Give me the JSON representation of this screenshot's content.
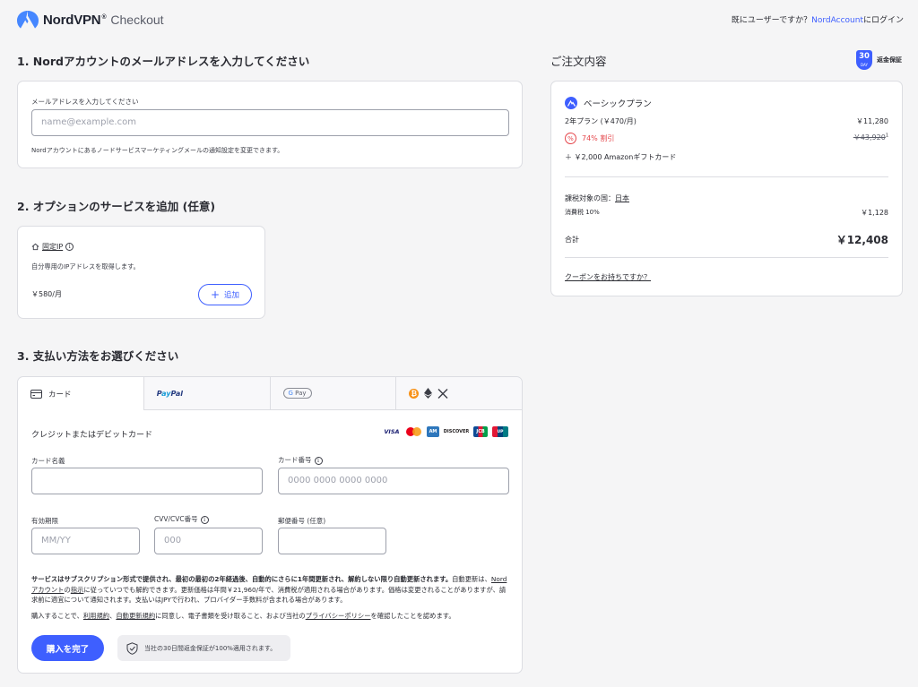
{
  "header": {
    "brand": "NordVPN",
    "tm": "®",
    "subtitle": "Checkout",
    "login_prefix": "既にユーザーですか？",
    "login_link": "NordAccount",
    "login_suffix": "にログイン"
  },
  "section1": {
    "title": "1. Nordアカウントのメールアドレスを入力してください",
    "email_label": "メールアドレスを入力してください",
    "email_placeholder": "name@example.com",
    "note": "Nordアカウントにあるノードサービスマーケティングメールの通知設定を変更できます。"
  },
  "section2": {
    "title": "2. オプションのサービスを追加 (任意)",
    "addon_name": "固定IP",
    "addon_desc": "自分専用のIPアドレスを取得します。",
    "addon_price": "￥580/月",
    "add_label": "追加"
  },
  "section3": {
    "title": "3. 支払い方法をお選びください",
    "tabs": [
      {
        "label": "カード",
        "icon": "card-icon"
      },
      {
        "label": "PayPal",
        "icon": "paypal-icon"
      },
      {
        "label": "G Pay",
        "icon": "gpay-icon"
      },
      {
        "label": "",
        "icon": "crypto-icons"
      }
    ],
    "card_heading": "クレジットまたはデビットカード",
    "brands": [
      "VISA",
      "DISCOVER",
      "JCB"
    ],
    "cardholder_label": "カード名義",
    "cardnumber_label": "カード番号",
    "cardnumber_placeholder": "0000 0000 0000 0000",
    "expiry_label": "有効期限",
    "expiry_placeholder": "MM/YY",
    "cvv_label": "CVV/CVC番号",
    "cvv_placeholder": "000",
    "zip_label": "郵便番号 (任意)",
    "terms_bold": "サービスはサブスクリプション形式で提供され、最初の最初の2年経過後、自動的にさらに1年間更新され、解約しない限り自動更新されます。",
    "terms_1": "自動更新は、",
    "terms_link1": "Nordアカウント",
    "terms_2": "の",
    "terms_link2": "指示",
    "terms_3": "に従っていつでも解約できます。更新価格は年間￥21,960/年で、消費税が適用される場合があります。価格は変更されることがありますが、請求前に適宜について通知されます。支払いはJPYで行われ、プロバイダー手数料が含まれる場合があります。",
    "consent_1": "購入することで、",
    "consent_link1": "利用規約",
    "consent_2": "、",
    "consent_link2": "自動更新規約",
    "consent_3": "に同意し、電子書類を受け取ること、および当社の",
    "consent_link3": "プライバシーポリシー",
    "consent_4": "を確認したことを認めます。",
    "buy_label": "購入を完了",
    "guarantee": "当社の30日間返金保証が100%適用されます。"
  },
  "summary": {
    "title": "ご注文内容",
    "badge_num": "30",
    "badge_sub": "DAY",
    "badge_label": "返金保証",
    "plan_name": "ベーシックプラン",
    "plan_term": "2年プラン (￥470/月)",
    "plan_price": "￥11,280",
    "discount": "74% 割引",
    "original_price": "￥43,920",
    "footnote": "1",
    "gift": "＋ ￥2,000 Amazonギフトカード",
    "tax_country_label": "課税対象の国：",
    "tax_country": "日本",
    "tax_label": "消費税 10%",
    "tax_value": "￥1,128",
    "total_label": "合計",
    "total_value": "￥12,408",
    "coupon": "クーポンをお持ちですか？"
  },
  "colors": {
    "accent": "#3e5fff",
    "discount": "#e5484d"
  }
}
